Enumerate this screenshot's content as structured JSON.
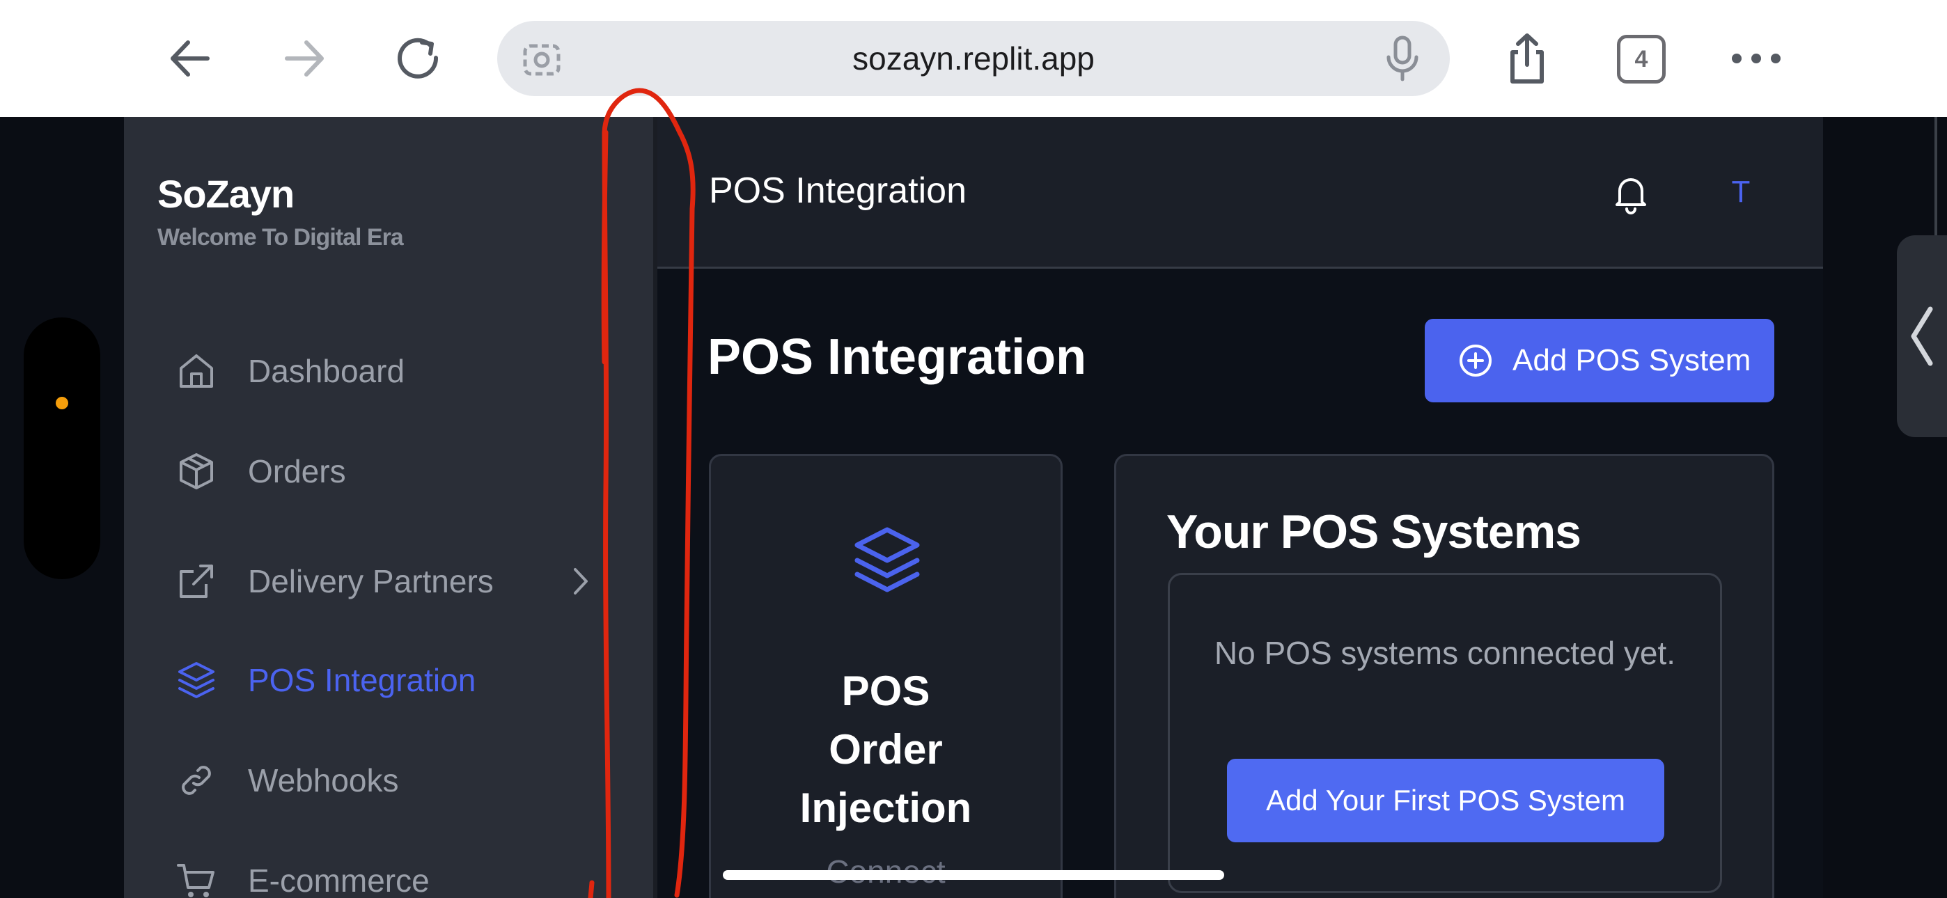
{
  "browser": {
    "url": "sozayn.replit.app",
    "tab_count": "4"
  },
  "brand": {
    "title": "SoZayn",
    "subtitle": "Welcome To Digital Era"
  },
  "sidebar": {
    "items": [
      {
        "label": "Dashboard",
        "icon": "home-icon"
      },
      {
        "label": "Orders",
        "icon": "package-icon"
      },
      {
        "label": "Delivery Partners",
        "icon": "external-link-icon"
      },
      {
        "label": "POS Integration",
        "icon": "layers-icon",
        "active": true
      },
      {
        "label": "Webhooks",
        "icon": "link-icon"
      },
      {
        "label": "E-commerce",
        "icon": "cart-icon"
      }
    ]
  },
  "header": {
    "title": "POS Integration",
    "avatar_initial": "T"
  },
  "main": {
    "page_title": "POS Integration",
    "add_button": "Add POS System",
    "feature_card": {
      "title_line1": "POS",
      "title_line2": "Order",
      "title_line3": "Injection",
      "subtitle": "Connect"
    },
    "systems_card": {
      "title": "Your POS Systems",
      "empty_message": "No POS systems connected yet.",
      "first_button": "Add Your First POS System"
    }
  },
  "colors": {
    "accent": "#4b63ee",
    "sidebar_bg": "#2a2e37",
    "main_bg": "#0c1018",
    "annotation": "#e0260f"
  }
}
